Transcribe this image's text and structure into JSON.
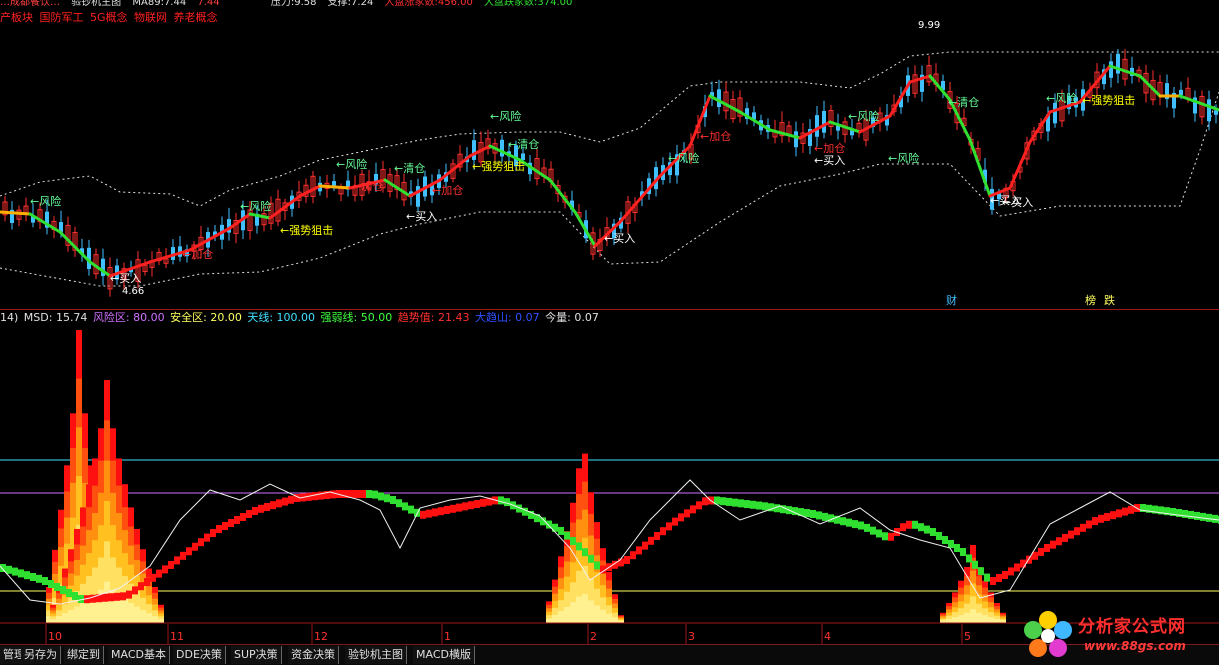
{
  "header": {
    "items": [
      {
        "text": "…成都餐饮…",
        "color": "#ff4040"
      },
      {
        "text": "验钞机主图",
        "color": "#e0e0e0"
      },
      {
        "text": "MA89:7.44",
        "color": "#e0e0e0"
      },
      {
        "text": "7.44",
        "color": "#ff4040"
      },
      {
        "text": "压力:9.58",
        "color": "#e0e0e0"
      },
      {
        "text": "支撑:7.24",
        "color": "#e0e0e0"
      },
      {
        "text": "大盘涨家数:456.00",
        "color": "#ff3030"
      },
      {
        "text": "大盘跌家数:374.00",
        "color": "#30e030"
      }
    ]
  },
  "concept_tags": [
    "产板块",
    "国防军工",
    "5G概念",
    "物联网",
    "养老概念"
  ],
  "main_chart": {
    "high_label": "9.99",
    "low_label": "4.66",
    "signals": [
      {
        "text": "←风险",
        "color": "#66ff99"
      },
      {
        "text": "←买入",
        "color": "#ffffff"
      },
      {
        "text": "←加仓",
        "color": "#ff3030"
      },
      {
        "text": "←风险",
        "color": "#66ff99"
      },
      {
        "text": "←强势狙击",
        "color": "#ffff00"
      },
      {
        "text": "←风险",
        "color": "#66ff99"
      },
      {
        "text": "←加仓",
        "color": "#ff3030"
      },
      {
        "text": "←清仓",
        "color": "#66ff99"
      },
      {
        "text": "←加仓",
        "color": "#ff3030"
      },
      {
        "text": "←买入",
        "color": "#ffffff"
      },
      {
        "text": "←风险",
        "color": "#66ff99"
      },
      {
        "text": "←清仓",
        "color": "#66ff99"
      },
      {
        "text": "←强势狙击",
        "color": "#ffff00"
      },
      {
        "text": "←买入",
        "color": "#ffffff"
      },
      {
        "text": "←风险",
        "color": "#66ff99"
      },
      {
        "text": "←加仓",
        "color": "#ff3030"
      },
      {
        "text": "←风险",
        "color": "#66ff99"
      },
      {
        "text": "←加仓",
        "color": "#ff3030"
      },
      {
        "text": "←买入",
        "color": "#ffffff"
      },
      {
        "text": "←风险",
        "color": "#66ff99"
      },
      {
        "text": "←清仓",
        "color": "#66ff99"
      },
      {
        "text": "←买入",
        "color": "#ffffff"
      },
      {
        "text": "←风险",
        "color": "#66ff99"
      },
      {
        "text": "←强势狙击",
        "color": "#ffff00"
      },
      {
        "text": "←买入",
        "color": "#ffffff"
      }
    ],
    "event_markers": [
      "财",
      "榜",
      "跌"
    ]
  },
  "indicator": {
    "items": [
      {
        "text": "14)",
        "color": "#e0e0e0"
      },
      {
        "text": "MSD: 15.74",
        "color": "#e0e0e0"
      },
      {
        "text": "风险区: 80.00",
        "color": "#d070ff"
      },
      {
        "text": "安全区: 20.00",
        "color": "#ffff60"
      },
      {
        "text": "天线: 100.00",
        "color": "#40e0ff"
      },
      {
        "text": "强弱线: 50.00",
        "color": "#40ff40"
      },
      {
        "text": "趋势值: 21.43",
        "color": "#ff3030"
      },
      {
        "text": "大趋山: 0.07",
        "color": "#3050ff"
      },
      {
        "text": "今量: 0.07",
        "color": "#e0e0e0"
      }
    ]
  },
  "x_axis": [
    "10",
    "11",
    "12",
    "1",
    "2",
    "3",
    "4",
    "5"
  ],
  "toolbar": {
    "tabs": [
      "管理",
      "另存为",
      "绑定到",
      "MACD基本",
      "DDE决策",
      "SUP决策",
      "资金决策",
      "验钞机主图",
      "MACD横版"
    ]
  },
  "watermark": {
    "title": "分析家公式网",
    "url": "www.88gs.com"
  }
}
